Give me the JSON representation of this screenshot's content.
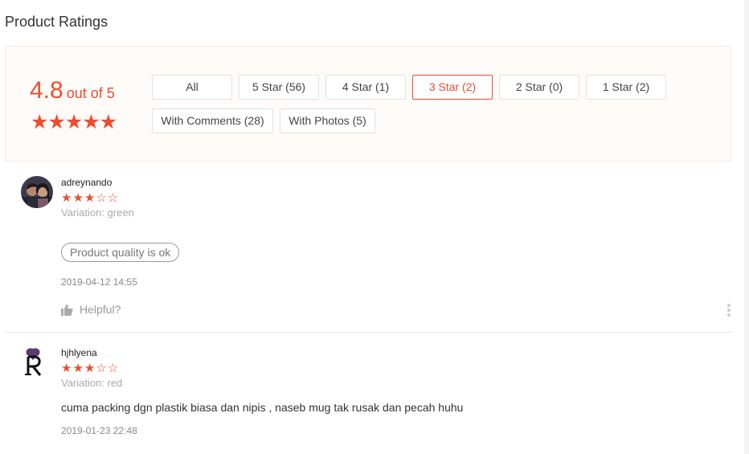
{
  "page": {
    "title": "Product Ratings"
  },
  "summary": {
    "score": "4.8",
    "score_suffix": "out of 5",
    "stars": "★★★★★"
  },
  "filters": [
    {
      "label": "All",
      "active": false
    },
    {
      "label": "5 Star (56)",
      "active": false
    },
    {
      "label": "4 Star (1)",
      "active": false
    },
    {
      "label": "3 Star (2)",
      "active": true
    },
    {
      "label": "2 Star (0)",
      "active": false
    },
    {
      "label": "1 Star (2)",
      "active": false
    },
    {
      "label": "With Comments (28)",
      "active": false
    },
    {
      "label": "With Photos (5)",
      "active": false
    }
  ],
  "colors": {
    "accent": "#ee4d2d",
    "muted": "#aaaaaa",
    "summary_bg": "#fffbf8"
  },
  "reviews": [
    {
      "username": "adreynando",
      "rating": 3,
      "stars": "★★★☆☆",
      "variation": "Variation: green",
      "tag": "Product quality is ok",
      "date": "2019-04-12 14:55",
      "helpful": "Helpful?"
    },
    {
      "username": "hjhlyena",
      "rating": 3,
      "stars": "★★★☆☆",
      "variation": "Variation: red",
      "comment": "cuma packing dgn plastik biasa dan nipis , naseb mug tak rusak dan pecah huhu",
      "date": "2019-01-23 22:48"
    }
  ],
  "icons": {
    "thumb": "thumbs-up-icon",
    "more": "more-vertical-icon"
  }
}
